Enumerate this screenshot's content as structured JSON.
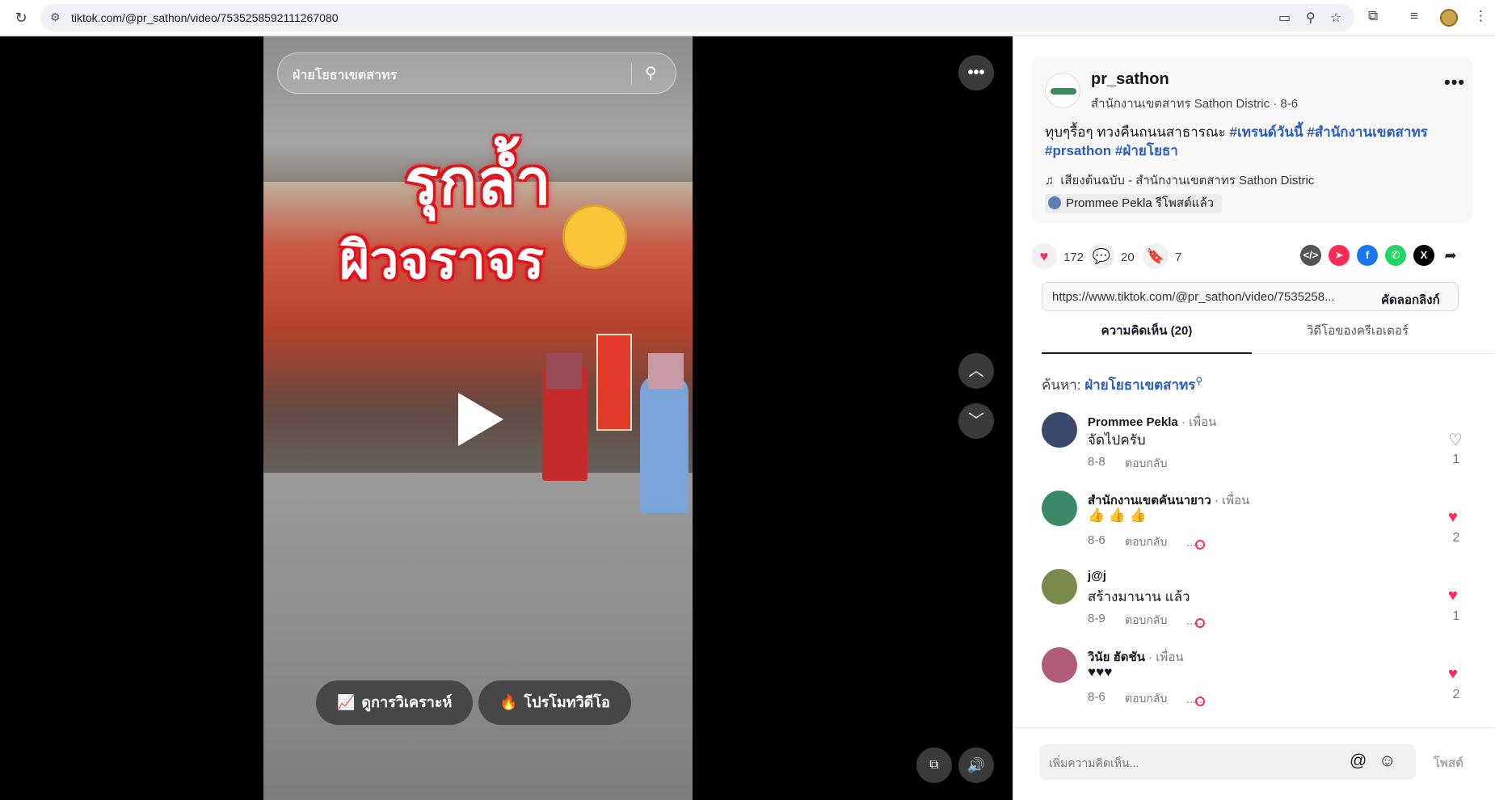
{
  "browser": {
    "url": "tiktok.com/@pr_sathon/video/7535258592111267080",
    "reload_icon": "reload-icon",
    "icons": [
      "install-icon",
      "zoom-icon",
      "bookmark-star-icon",
      "extensions-icon",
      "media-icon",
      "profile-avatar",
      "menu-kebab-icon"
    ]
  },
  "video": {
    "search_placeholder": "ฝ่ายโยธาเขตสาทร",
    "overlay_line1": "รุกล้ำ",
    "overlay_line2": "ผิวจราจร",
    "analytics_button": "ดูการวิเคราะห์",
    "promote_button": "โปรโมทวิดีโอ"
  },
  "post": {
    "username": "pr_sathon",
    "nickname_date": "สำนักงานเขตสาทร Sathon Distric · 8-6",
    "description_plain": "ทุบๆรื้อๆ ทวงคืนถนนสาธารณะ ",
    "hashtags": [
      "#เทรนด์วันนี้",
      "#สำนักงานเขตสาทร",
      "#prsathon",
      "#ฝ่ายโยธา"
    ],
    "music": "เสียงต้นฉบับ - สำนักงานเขตสาทร Sathon Distric",
    "repost": "Prommee Pekla รีโพสต์แล้ว"
  },
  "stats": {
    "likes": "172",
    "comments": "20",
    "favorites": "7"
  },
  "share_icons": [
    {
      "name": "embed-icon",
      "glyph": "</>",
      "color": "#555555"
    },
    {
      "name": "send-to-friends-icon",
      "glyph": "➤",
      "color": "#fe2c55"
    },
    {
      "name": "facebook-icon",
      "glyph": "f",
      "color": "#1877f2"
    },
    {
      "name": "whatsapp-icon",
      "glyph": "✆",
      "color": "#25d366"
    },
    {
      "name": "x-icon",
      "glyph": "𝕏",
      "color": "#000000"
    }
  ],
  "link": {
    "url": "https://www.tiktok.com/@pr_sathon/video/7535258...",
    "copy_label": "คัดลอกลิงก์"
  },
  "tabs": {
    "comments": "ความคิดเห็น (20)",
    "creator_videos": "วิดีโอของครีเอเตอร์"
  },
  "search": {
    "prefix": "ค้นหา:",
    "query": "ฝ่ายโยธาเขตสาทร"
  },
  "comments": [
    {
      "name": "Prommee Pekla",
      "tag": "· เพื่อน",
      "text": "จัดไปครับ",
      "date": "8-8",
      "reply": "ตอบกลับ",
      "likes": "1",
      "liked": false,
      "avatar_color": "#3b4a6b"
    },
    {
      "name": "สำนักงานเขตคันนายาว",
      "tag": "· เพื่อน",
      "text": "👍 👍 👍",
      "date": "8-6",
      "reply": "ตอบกลับ",
      "likes": "2",
      "liked": true,
      "avatar_color": "#3a8a6a"
    },
    {
      "name": "j@j",
      "tag": "",
      "text": "สร้างมานาน แล้ว",
      "date": "8-9",
      "reply": "ตอบกลับ",
      "likes": "1",
      "liked": true,
      "avatar_color": "#7a8a4a"
    },
    {
      "name": "วินัย ฮัดชัน",
      "tag": "· เพื่อน",
      "text": "♥♥♥",
      "date": "8-6",
      "reply": "ตอบกลับ",
      "likes": "2",
      "liked": true,
      "avatar_color": "#b15a7a"
    }
  ],
  "comment_bar": {
    "placeholder": "เพิ่มความคิดเห็น...",
    "post": "โพสต์"
  }
}
